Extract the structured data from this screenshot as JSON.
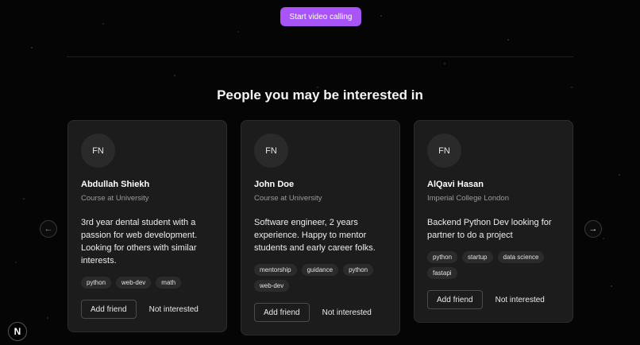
{
  "header": {
    "video_button_label": "Start video calling"
  },
  "section": {
    "title": "People you may be interested in"
  },
  "carousel": {
    "prev_icon": "arrow-left-icon",
    "next_icon": "arrow-right-icon",
    "cards": [
      {
        "initials": "FN",
        "name": "Abdullah Shiekh",
        "subtitle": "Course at University",
        "bio": "3rd year dental student with a passion for web development. Looking for others with similar interests.",
        "tags": [
          "python",
          "web-dev",
          "math"
        ],
        "add_label": "Add friend",
        "not_interested_label": "Not interested"
      },
      {
        "initials": "FN",
        "name": "John Doe",
        "subtitle": "Course at University",
        "bio": "Software engineer, 2 years experience. Happy to mentor students and early career folks.",
        "tags": [
          "mentorship",
          "guidance",
          "python",
          "web-dev"
        ],
        "add_label": "Add friend",
        "not_interested_label": "Not interested"
      },
      {
        "initials": "FN",
        "name": "AlQavi Hasan",
        "subtitle": "Imperial College London",
        "bio": "Backend Python Dev looking for partner to do a project",
        "tags": [
          "python",
          "startup",
          "data science",
          "fastapi"
        ],
        "add_label": "Add friend",
        "not_interested_label": "Not interested"
      }
    ]
  },
  "footer": {
    "logo_letter": "N"
  },
  "colors": {
    "accent": "#a855f7",
    "background": "#050505",
    "card": "#1c1c1c"
  }
}
